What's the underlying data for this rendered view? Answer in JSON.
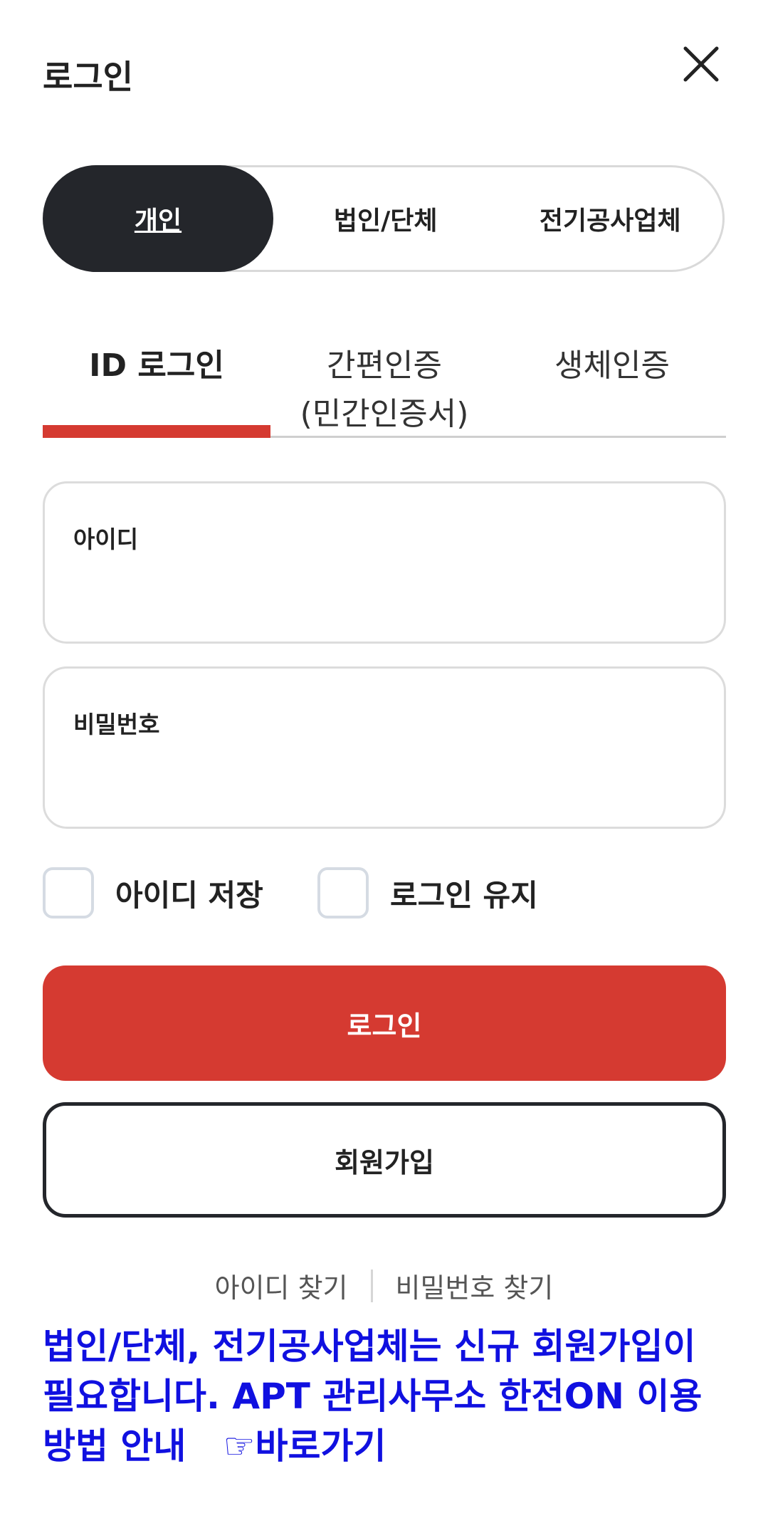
{
  "header": {
    "title": "로그인"
  },
  "close": {
    "icon": "close-icon"
  },
  "member_types": [
    {
      "label": "개인",
      "active": true
    },
    {
      "label": "법인/단체",
      "active": false
    },
    {
      "label": "전기공사업체",
      "active": false
    }
  ],
  "login_tabs": [
    {
      "label": "ID 로그인",
      "active": true
    },
    {
      "label": "간편인증\n(민간인증서)",
      "active": false
    },
    {
      "label": "생체인증",
      "active": false
    }
  ],
  "id_field": {
    "label": "아이디",
    "value": ""
  },
  "password_field": {
    "label": "비밀번호",
    "value": ""
  },
  "options": {
    "save_id_label": "아이디 저장",
    "save_id_checked": false,
    "keep_login_label": "로그인 유지",
    "keep_login_checked": false
  },
  "buttons": {
    "login_label": "로그인",
    "signup_label": "회원가입"
  },
  "find_links": {
    "find_id": "아이디 찾기",
    "find_password": "비밀번호 찾기"
  },
  "notice": {
    "text": "법인/단체, 전기공사업체는 신규 회원가입이 필요합니다. APT 관리사무소 한전ON 이용방법 안내",
    "link_label": "☞바로가기"
  },
  "colors": {
    "accent": "#d53a31",
    "dark": "#24262b",
    "notice": "#1010e0"
  }
}
